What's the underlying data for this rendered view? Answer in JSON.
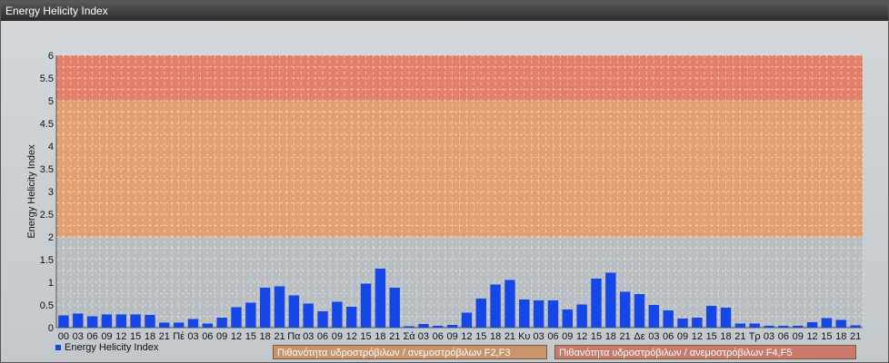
{
  "window": {
    "title": "Energy Helicity Index"
  },
  "chart_data": {
    "type": "bar",
    "title": "",
    "xlabel": "",
    "ylabel": "Energy Helicity Index",
    "ylim": [
      0,
      6
    ],
    "yticks": [
      "0",
      "0.5",
      "1",
      "1.5",
      "2",
      "2.5",
      "3",
      "3.5",
      "4",
      "4.5",
      "5",
      "5.5",
      "6"
    ],
    "grid": true,
    "categories": [
      "00",
      "03",
      "06",
      "09",
      "12",
      "15",
      "18",
      "21",
      "Πέ",
      "03",
      "06",
      "09",
      "12",
      "15",
      "18",
      "21",
      "Πα",
      "03",
      "06",
      "09",
      "12",
      "15",
      "18",
      "21",
      "Σά",
      "03",
      "06",
      "09",
      "12",
      "15",
      "18",
      "21",
      "Κυ",
      "03",
      "06",
      "09",
      "12",
      "15",
      "18",
      "21",
      "Δε",
      "03",
      "06",
      "09",
      "12",
      "15",
      "18",
      "21",
      "Τρ",
      "03",
      "06",
      "09",
      "12",
      "15",
      "18",
      "21"
    ],
    "series": [
      {
        "name": "Energy Helicity Index",
        "color": "#1447e6",
        "values": [
          0.27,
          0.31,
          0.25,
          0.29,
          0.29,
          0.29,
          0.28,
          0.11,
          0.11,
          0.19,
          0.09,
          0.22,
          0.45,
          0.55,
          0.88,
          0.91,
          0.71,
          0.53,
          0.36,
          0.57,
          0.46,
          0.97,
          1.3,
          0.88,
          0.03,
          0.08,
          0.04,
          0.06,
          0.33,
          0.64,
          0.95,
          1.05,
          0.62,
          0.6,
          0.6,
          0.4,
          0.51,
          1.08,
          1.21,
          0.79,
          0.74,
          0.5,
          0.38,
          0.2,
          0.22,
          0.48,
          0.44,
          0.09,
          0.09,
          0.04,
          0.04,
          0.04,
          0.12,
          0.21,
          0.17,
          0.05
        ]
      }
    ],
    "bands": [
      {
        "from": 0,
        "to": 2,
        "color": "#b9bec3",
        "label": ""
      },
      {
        "from": 2,
        "to": 5,
        "color": "#e2a070",
        "label": "Πιθανότητα υδροστρόβιλων / ανεμοστρόβιλων F2,F3"
      },
      {
        "from": 5,
        "to": 6,
        "color": "#e2806a",
        "label": "Πιθανότητα υδροστρόβιλων / ανεμοστρόβιλων F4,F5"
      }
    ],
    "legend_position": "bottom-left"
  }
}
